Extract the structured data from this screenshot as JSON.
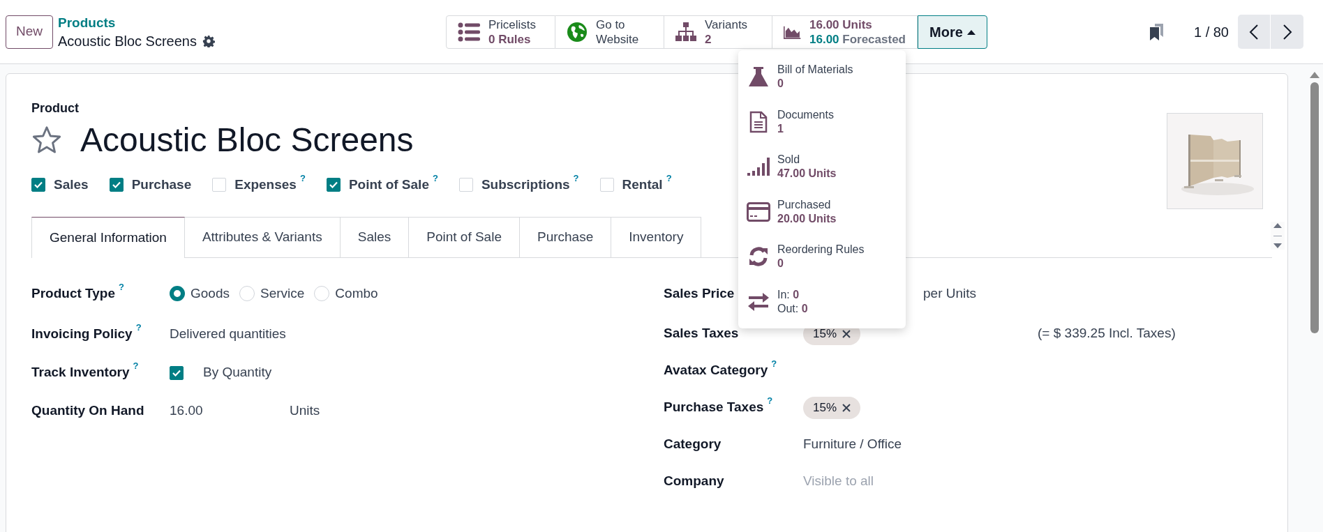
{
  "top_bar": {
    "new_button": "New",
    "breadcrumb": {
      "parent": "Products",
      "current": "Acoustic Bloc Screens"
    },
    "stat_buttons": [
      {
        "kind": "pricelists",
        "title": "Pricelists",
        "value": "0",
        "unit": "Rules"
      },
      {
        "kind": "website",
        "title": "Go to",
        "subtitle": "Website"
      },
      {
        "kind": "variants",
        "title": "Variants",
        "value": "2"
      },
      {
        "kind": "forecast",
        "value": "16.00",
        "unit": "Units",
        "forecast_value": "16.00",
        "forecast_label": "Forecasted"
      }
    ],
    "more_button": {
      "label": "More",
      "expanded": true
    },
    "more_menu": [
      {
        "kind": "bom",
        "title": "Bill of Materials",
        "value": "0"
      },
      {
        "kind": "documents",
        "title": "Documents",
        "value": "1"
      },
      {
        "kind": "sold",
        "title": "Sold",
        "value": "47.00 Units"
      },
      {
        "kind": "purchased",
        "title": "Purchased",
        "value": "20.00 Units"
      },
      {
        "kind": "reordering",
        "title": "Reordering Rules",
        "value": "0"
      },
      {
        "kind": "moves",
        "in_label": "In:",
        "in_value": "0",
        "out_label": "Out:",
        "out_value": "0"
      }
    ],
    "pager": "1 / 80"
  },
  "form": {
    "label": "Product",
    "name": "Acoustic Bloc Screens",
    "favorite": false,
    "checkboxes": [
      {
        "label": "Sales",
        "checked": true
      },
      {
        "label": "Purchase",
        "checked": true
      },
      {
        "label": "Expenses",
        "checked": false,
        "help": "?"
      },
      {
        "label": "Point of Sale",
        "checked": true,
        "help": "?"
      },
      {
        "label": "Subscriptions",
        "checked": false,
        "help": "?"
      },
      {
        "label": "Rental",
        "checked": false,
        "help": "?"
      }
    ],
    "tabs": [
      {
        "label": "General Information",
        "selected": true
      },
      {
        "label": "Attributes & Variants",
        "selected": false
      },
      {
        "label": "Sales",
        "selected": false
      },
      {
        "label": "Point of Sale",
        "selected": false
      },
      {
        "label": "Purchase",
        "selected": false
      },
      {
        "label": "Inventory",
        "selected": false
      }
    ],
    "left_fields": [
      {
        "kind": "radio",
        "label": "Product Type",
        "help": "?",
        "options": [
          {
            "label": "Goods",
            "selected": true
          },
          {
            "label": "Service",
            "selected": false
          },
          {
            "label": "Combo",
            "selected": false
          }
        ]
      },
      {
        "kind": "text",
        "label": "Invoicing Policy",
        "help": "?",
        "value": "Delivered quantities"
      },
      {
        "kind": "checkbox",
        "label": "Track Inventory",
        "help": "?",
        "checked": true,
        "value": "By Quantity"
      },
      {
        "kind": "quantity",
        "label": "Quantity On Hand",
        "value": "16.00",
        "unit": "Units"
      }
    ],
    "right_fields": [
      {
        "kind": "price",
        "label": "Sales Price",
        "unit": "per Units"
      },
      {
        "kind": "tags",
        "label": "Sales Taxes",
        "tags": [
          "15%"
        ],
        "note": "(= $ 339.25 Incl. Taxes)"
      },
      {
        "kind": "text",
        "label": "Avatax Category",
        "help": "?"
      },
      {
        "kind": "tags",
        "label": "Purchase Taxes",
        "help": "?",
        "tags": [
          "15%"
        ]
      },
      {
        "kind": "text",
        "label": "Category",
        "value": "Furniture / Office"
      },
      {
        "kind": "text",
        "label": "Company",
        "placeholder": "Visible to all"
      }
    ]
  }
}
